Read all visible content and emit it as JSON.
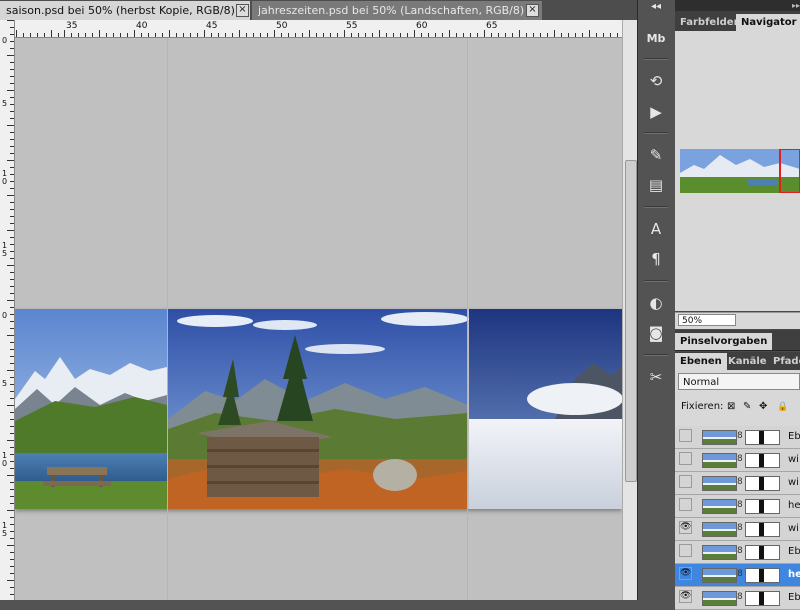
{
  "tabs": [
    {
      "label": "saison.psd bei 50% (herbst Kopie, RGB/8) *",
      "active": true
    },
    {
      "label": "jahreszeiten.psd bei 50% (Landschaften, RGB/8) *",
      "active": false
    }
  ],
  "tab_close_glyph": "×",
  "ruler": {
    "h_labels": [
      "35",
      "40",
      "45",
      "50",
      "55",
      "60",
      "65"
    ],
    "v_labels": [
      "0",
      "5",
      "10",
      "15",
      "0",
      "5",
      "10",
      "15"
    ]
  },
  "toolstrip": {
    "collapse_glyph": "◂◂",
    "tools": [
      {
        "name": "mini-bridge-icon",
        "glyph": "Mb"
      },
      {
        "name": "history-icon",
        "glyph": "⟲"
      },
      {
        "name": "actions-icon",
        "glyph": "▶"
      },
      {
        "name": "brush-icon",
        "glyph": "✎"
      },
      {
        "name": "clone-source-icon",
        "glyph": "▤"
      },
      {
        "name": "character-icon",
        "glyph": "A"
      },
      {
        "name": "paragraph-icon",
        "glyph": "¶"
      },
      {
        "name": "adjustments-icon",
        "glyph": "◐"
      },
      {
        "name": "masks-icon",
        "glyph": "◙"
      },
      {
        "name": "tools-preset-icon",
        "glyph": "✂"
      }
    ]
  },
  "navigator": {
    "panel_collapse_glyph": "▸▸",
    "tabs": [
      {
        "label": "Farbfelder",
        "active": false
      },
      {
        "label": "Navigator",
        "active": true
      }
    ],
    "zoom": "50%"
  },
  "brush_presets": {
    "label": "Pinselvorgaben"
  },
  "layers": {
    "tabs": [
      {
        "label": "Ebenen",
        "active": true
      },
      {
        "label": "Kanäle",
        "active": false
      },
      {
        "label": "Pfade",
        "active": false
      }
    ],
    "blend_mode": "Normal",
    "lock_label": "Fixieren:",
    "lock_glyphs": [
      "⊠",
      "✎",
      "✥",
      "🔒"
    ],
    "chain_glyph": "8",
    "eye_glyph": "👁",
    "rows": [
      {
        "name": "Eb",
        "visible": false,
        "selected": false
      },
      {
        "name": "wi",
        "visible": false,
        "selected": false
      },
      {
        "name": "wi",
        "visible": false,
        "selected": false
      },
      {
        "name": "he",
        "visible": false,
        "selected": false
      },
      {
        "name": "wi",
        "visible": true,
        "selected": false
      },
      {
        "name": "Eb",
        "visible": false,
        "selected": false
      },
      {
        "name": "he",
        "visible": true,
        "selected": true
      },
      {
        "name": "Eb",
        "visible": true,
        "selected": false
      }
    ]
  },
  "colors": {
    "guide": "#4fe0e0",
    "canvas": "#c0c0c0",
    "selection": "#3f86e0",
    "navigator_frame": "#e02020"
  }
}
